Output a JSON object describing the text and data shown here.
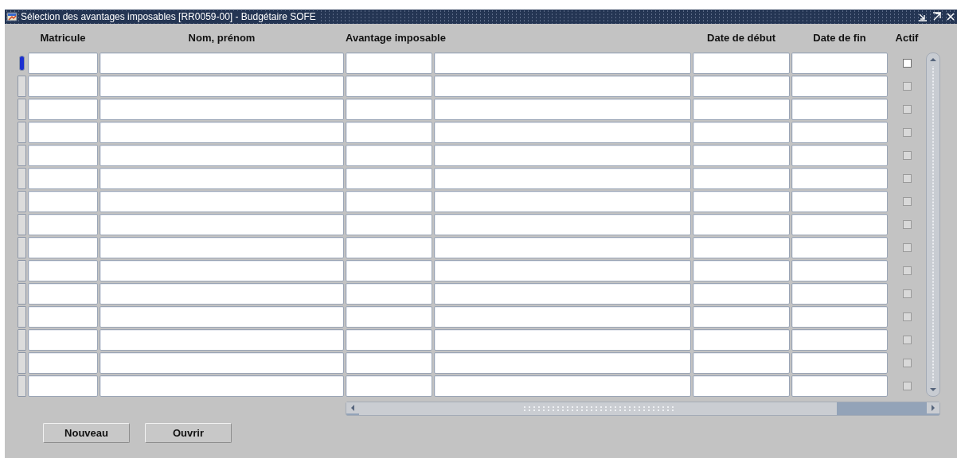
{
  "window": {
    "title": "Sélection des avantages imposables [RR0059-00] - Budgétaire SOFE"
  },
  "columns": [
    {
      "kind": "text",
      "label": "Matricule"
    },
    {
      "kind": "text",
      "label": "Nom, prénom"
    },
    {
      "kind": "code_and_text",
      "label": "Avantage imposable"
    },
    {
      "kind": "text",
      "label": "Date de début"
    },
    {
      "kind": "text",
      "label": "Date de fin"
    },
    {
      "kind": "check",
      "label": "Actif"
    }
  ],
  "rows": [
    {
      "selected": true,
      "checked": false,
      "disabled": false
    },
    {
      "selected": false,
      "checked": false,
      "disabled": true
    },
    {
      "selected": false,
      "checked": false,
      "disabled": true
    },
    {
      "selected": false,
      "checked": false,
      "disabled": true
    },
    {
      "selected": false,
      "checked": false,
      "disabled": true
    },
    {
      "selected": false,
      "checked": false,
      "disabled": true
    },
    {
      "selected": false,
      "checked": false,
      "disabled": true
    },
    {
      "selected": false,
      "checked": false,
      "disabled": true
    },
    {
      "selected": false,
      "checked": false,
      "disabled": true
    },
    {
      "selected": false,
      "checked": false,
      "disabled": true
    },
    {
      "selected": false,
      "checked": false,
      "disabled": true
    },
    {
      "selected": false,
      "checked": false,
      "disabled": true
    },
    {
      "selected": false,
      "checked": false,
      "disabled": true
    },
    {
      "selected": false,
      "checked": false,
      "disabled": true
    },
    {
      "selected": false,
      "checked": false,
      "disabled": true
    }
  ],
  "buttons": [
    "Nouveau",
    "Ouvrir"
  ]
}
